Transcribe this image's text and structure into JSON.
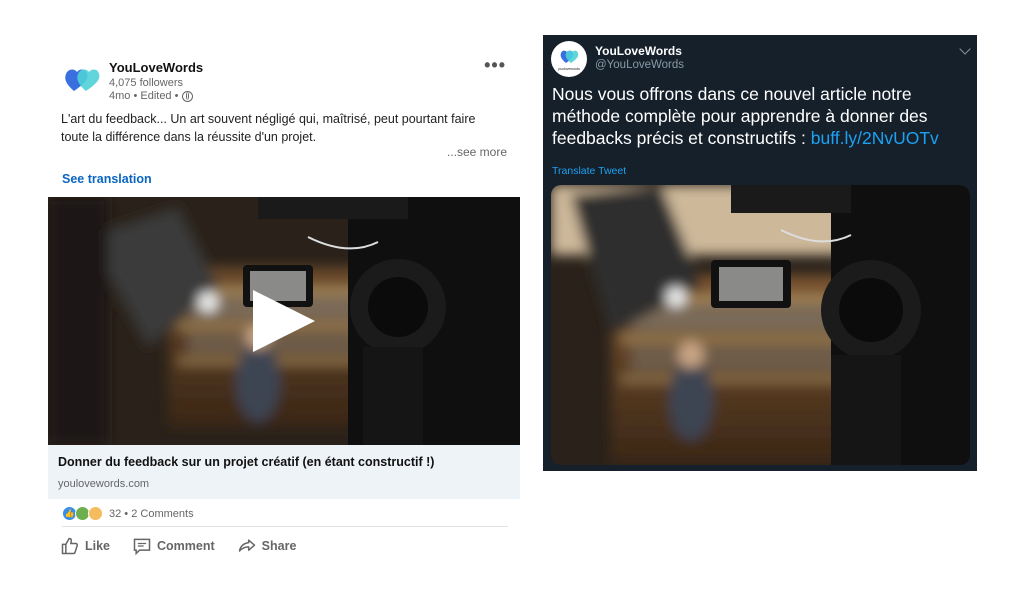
{
  "linkedin": {
    "author": "YouLoveWords",
    "followers": "4,075 followers",
    "meta": "4mo • Edited •",
    "text": "L'art du feedback... Un art souvent négligé qui, maîtrisé, peut pourtant faire toute la différence dans la réussite d'un projet.",
    "see_more": "...see more",
    "see_translation": "See translation",
    "link_title": "Donner du feedback sur un projet créatif (en étant constructif !)",
    "link_domain": "youlovewords.com",
    "reactions_count": "32",
    "comments": "2 Comments",
    "actions": {
      "like": "Like",
      "comment": "Comment",
      "share": "Share"
    },
    "colors": {
      "accent": "#0a66c2",
      "link_box": "#eef3f8"
    }
  },
  "twitter": {
    "name": "YouLoveWords",
    "handle": "@YouLoveWords",
    "text": "Nous vous offrons dans ce nouvel article notre méthode complète pour apprendre à donner des feedbacks précis et constructifs : ",
    "link": "buff.ly/2NvUOTv",
    "translate": "Translate Tweet",
    "avatar_caption": "youlovewords",
    "colors": {
      "background": "#15202b",
      "link": "#1da1f2"
    }
  },
  "icons": [
    "heart-logo-icon",
    "globe-icon",
    "more-options-icon",
    "like-icon",
    "comment-icon",
    "share-icon",
    "play-icon",
    "chevron-down-icon"
  ]
}
